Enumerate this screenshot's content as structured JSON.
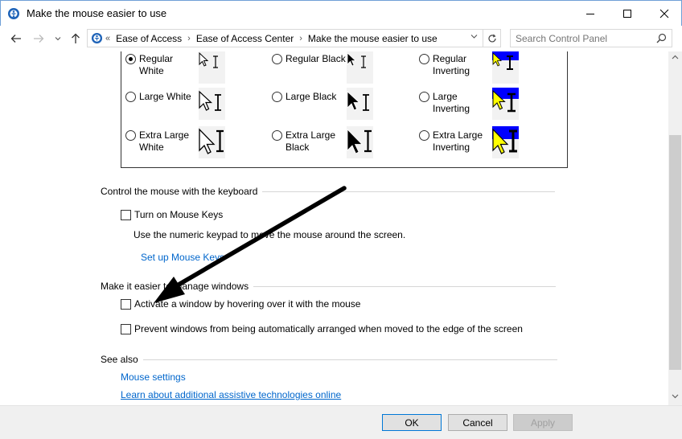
{
  "window": {
    "title": "Make the mouse easier to use"
  },
  "address": {
    "lead": "«",
    "crumbs": [
      "Ease of Access",
      "Ease of Access Center",
      "Make the mouse easier to use"
    ]
  },
  "search": {
    "placeholder": "Search Control Panel"
  },
  "pointers": {
    "options": [
      {
        "label": "Regular White",
        "selected": true
      },
      {
        "label": "Regular Black",
        "selected": false
      },
      {
        "label": "Regular Inverting",
        "selected": false
      },
      {
        "label": "Large White",
        "selected": false
      },
      {
        "label": "Large Black",
        "selected": false
      },
      {
        "label": "Large Inverting",
        "selected": false
      },
      {
        "label": "Extra Large White",
        "selected": false
      },
      {
        "label": "Extra Large Black",
        "selected": false
      },
      {
        "label": "Extra Large Inverting",
        "selected": false
      }
    ]
  },
  "keyboard": {
    "heading": "Control the mouse with the keyboard",
    "mouse_keys_label": "Turn on Mouse Keys",
    "mouse_keys_checked": false,
    "description": "Use the numeric keypad to move the mouse around the screen.",
    "setup_link": "Set up Mouse Keys"
  },
  "windows": {
    "heading": "Make it easier to manage windows",
    "hover_activate_label": "Activate a window by hovering over it with the mouse",
    "hover_activate_checked": false,
    "prevent_arrange_label": "Prevent windows from being automatically arranged when moved to the edge of the screen",
    "prevent_arrange_checked": false
  },
  "see_also": {
    "heading": "See also",
    "links": [
      "Mouse settings",
      "Learn about additional assistive technologies online"
    ]
  },
  "buttons": {
    "ok": "OK",
    "cancel": "Cancel",
    "apply": "Apply"
  },
  "colors": {
    "link": "#0066cc",
    "inverting_bg": "#0000ff",
    "inverting_arrow": "#ffff00"
  }
}
